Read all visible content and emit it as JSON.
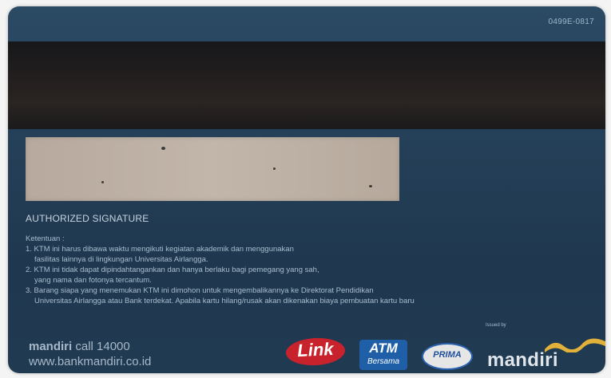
{
  "card": {
    "code": "0499E-0817",
    "authorized_signature": "AUTHORIZED SIGNATURE",
    "terms": {
      "heading": "Ketentuan :",
      "lines": [
        "1. KTM ini harus dibawa waktu mengikuti kegiatan akademik dan menggunakan",
        "fasilitas lainnya di lingkungan Universitas Airlangga.",
        "2. KTM ini tidak dapat dipindahtangankan dan hanya berlaku bagi pemegang yang sah,",
        "yang nama dan fotonya tercantum.",
        "3. Barang siapa yang menemukan KTM ini dimohon untuk mengembalikannya ke Direktorat Pendidikan",
        "Universitas Airlangga atau Bank terdekat. Apabila kartu hilang/rusak akan dikenakan biaya pembuatan kartu baru"
      ]
    },
    "issued_by": "Issued by",
    "contact": {
      "brand": "mandiri",
      "call": "call 14000",
      "website": "www.bankmandiri.co.id"
    },
    "logos": {
      "link": "Link",
      "atm_top": "ATM",
      "atm_bottom": "Bersama",
      "prima": "PRIMA",
      "mandiri": "mandiri"
    },
    "colors": {
      "card_blue": "#243f57",
      "stripe": "#1f1c1d",
      "signature_panel": "#bfb1a5",
      "link_red": "#c8232c",
      "atm_blue": "#1f5fa8",
      "mandiri_gold": "#e2b13a"
    }
  }
}
